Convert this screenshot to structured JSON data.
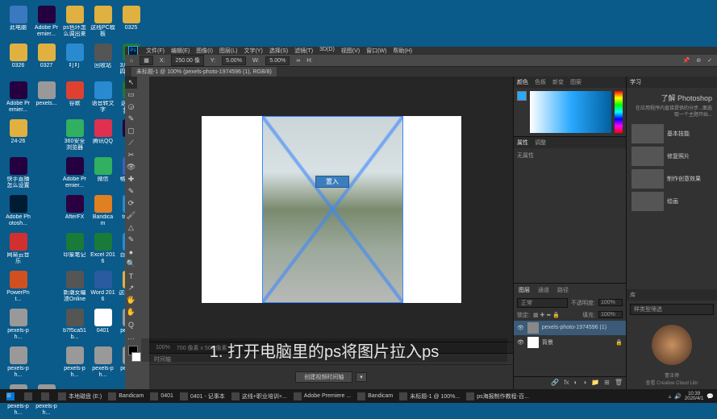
{
  "desktop": {
    "icons": [
      {
        "label": "此电脑",
        "color": "#3a78c0"
      },
      {
        "label": "Adobe Premier...",
        "color": "#240040"
      },
      {
        "label": "ps色环怎么调出来2",
        "color": "#e0b040"
      },
      {
        "label": "这线PC模板",
        "color": "#e0b040"
      },
      {
        "label": "0325",
        "color": "#e0b040"
      },
      {
        "label": "0326",
        "color": "#e0b040",
        "col": 5
      },
      {
        "label": "0327",
        "color": "#e0b040",
        "col": 6
      },
      {
        "label": "叮叮",
        "color": "#2a8ad0"
      },
      {
        "label": "回收站",
        "color": "#555"
      },
      {
        "label": "3月20日-四主词包第7...",
        "color": "#1a7a3a"
      },
      {
        "label": "Adobe Premier...",
        "color": "#240040"
      },
      {
        "label": "pexels...",
        "color": "#999"
      },
      {
        "label": "谷歌",
        "color": "#e04030"
      },
      {
        "label": "语音转文字",
        "color": "#2a8ad0"
      },
      {
        "label": "这线+职业培训+第4批...",
        "color": "#1a7a3a"
      },
      {
        "label": "24-26",
        "color": "#e0b040"
      },
      {
        "label": "",
        "color": "transparent"
      },
      {
        "label": "360安全浏览器",
        "color": "#30b060"
      },
      {
        "label": "腾讯QQ",
        "color": "#e03050"
      },
      {
        "label": "模板",
        "color": "#240040"
      },
      {
        "label": "快手直播怎么设置",
        "color": "#240040"
      },
      {
        "label": "",
        "color": "transparent"
      },
      {
        "label": "Adobe Premier...",
        "color": "#240040"
      },
      {
        "label": "微信",
        "color": "#30b060"
      },
      {
        "label": "格式工厂",
        "color": "#4060c0"
      },
      {
        "label": "Adobe Photosh...",
        "color": "#001c33"
      },
      {
        "label": "",
        "color": "transparent"
      },
      {
        "label": "AfterFX",
        "color": "#2a0040"
      },
      {
        "label": "Bandicam",
        "color": "#e08020"
      },
      {
        "label": "tmg (1)",
        "color": "#2a8ad0"
      },
      {
        "label": "网易云音乐",
        "color": "#d03030"
      },
      {
        "label": "",
        "color": "transparent"
      },
      {
        "label": "印象笔记",
        "color": "#1a7a3a"
      },
      {
        "label": "Excel 2016",
        "color": "#1a7a3a"
      },
      {
        "label": "百度网盘",
        "color": "#2a8ad0"
      },
      {
        "label": "PowerPnt...",
        "color": "#d05020"
      },
      {
        "label": "",
        "color": "transparent"
      },
      {
        "label": "新潮女编渣Online",
        "color": "#555"
      },
      {
        "label": "Word 2016",
        "color": "#2a5aa0"
      },
      {
        "label": "这线PC模板",
        "color": "#e0b040"
      },
      {
        "label": "pexels-ph...",
        "color": "#999"
      },
      {
        "label": "",
        "color": "transparent"
      },
      {
        "label": "b7f5ca51b...",
        "color": "#555"
      },
      {
        "label": "0401",
        "color": "#fff"
      },
      {
        "label": "pexels-ph...",
        "color": "#999"
      },
      {
        "label": "pexels-ph...",
        "color": "#999"
      },
      {
        "label": "",
        "color": "transparent"
      },
      {
        "label": "pexels-ph...",
        "color": "#999"
      },
      {
        "label": "pexels-ph...",
        "color": "#999"
      },
      {
        "label": "pexels-ph...",
        "color": "#999"
      },
      {
        "label": "pexels-ph...",
        "color": "#999"
      },
      {
        "label": "pexels-ph...",
        "color": "#999"
      }
    ]
  },
  "ps": {
    "menu": [
      "文件(F)",
      "编辑(E)",
      "图像(I)",
      "图层(L)",
      "文字(Y)",
      "选择(S)",
      "滤镜(T)",
      "3D(D)",
      "视图(V)",
      "窗口(W)",
      "帮助(H)"
    ],
    "options": {
      "x_label": "X:",
      "x": "250.00 像",
      "y_label": "Y:",
      "y": "5.00%",
      "w_label": "W:",
      "w": "5.00%",
      "h_label": "H:"
    },
    "doc_tab": "未标题-1 @ 100% (pexels-photo-1974596 (1), RGB/8)",
    "place_label": "置入",
    "status": {
      "zoom": "100%",
      "doc": "700 像素 x 500 像素"
    },
    "timeline": {
      "tab": "时间轴",
      "btn": "创建视频时间轴"
    },
    "right": {
      "color_tabs": [
        "颜色",
        "色板",
        "新变",
        "图案"
      ],
      "props_tabs": [
        "属性",
        "调整"
      ],
      "props_body": "无属性",
      "learn_tab": "学习",
      "layers_tabs": [
        "图层",
        "通道",
        "路径"
      ],
      "blend": "正常",
      "opacity_lbl": "不透明度:",
      "opacity": "100%",
      "lock_lbl": "锁定:",
      "fill_lbl": "填充:",
      "fill": "100%",
      "layer1": "pexels-photo-1974596 (1)",
      "layer2": "背景"
    },
    "learn": {
      "title": "了解 Photoshop",
      "sub": "在应用程序内直接提供的分步...面选取一个主题开始...",
      "items": [
        "基本技能",
        "修复照片",
        "制作创意效果",
        "绘画"
      ],
      "filter": "样类型筛选"
    }
  },
  "subtitle": "1. 打开电脑里的ps将图片拉入ps",
  "taskbar": {
    "items": [
      {
        "label": ""
      },
      {
        "label": ""
      },
      {
        "label": "本地磁盘 (E:)"
      },
      {
        "label": "Bandicam"
      },
      {
        "label": "0401"
      },
      {
        "label": "0401 - 记事本"
      },
      {
        "label": "这线+职业培训+..."
      },
      {
        "label": "Adobe Premiere ..."
      },
      {
        "label": "Bandicam"
      },
      {
        "label": "未标题-1 @ 100%..."
      },
      {
        "label": "ps海报制作教程-百..."
      }
    ],
    "time": "10:39",
    "date": "2020/4/1"
  }
}
